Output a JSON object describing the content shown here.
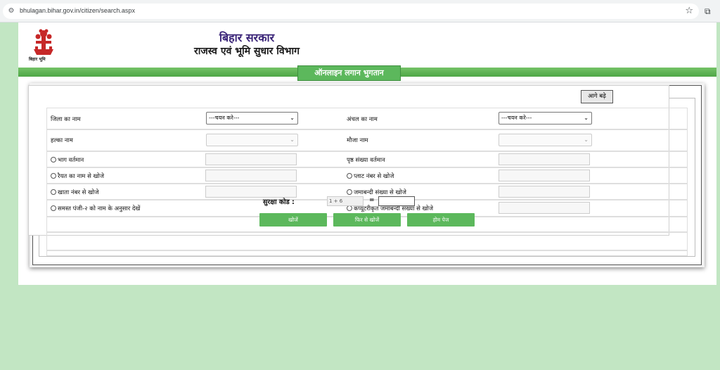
{
  "browser": {
    "url": "bhulagan.bihar.gov.in/citizen/search.aspx"
  },
  "header": {
    "emblem_caption": "बिहार भूमि",
    "title_line1": "बिहार सरकार",
    "title_line2": "राजस्व एवं भूमि सुधार विभाग"
  },
  "panel": {
    "legend": "ऑनलाइन लगान भुगतान"
  },
  "form": {
    "district_label": "जिला का नाम",
    "district_value": "---चयन करे---",
    "circle_label": "अंचल का नाम",
    "circle_value": "---चयन करे---",
    "next_button": "आगे बढ़े",
    "halka_label": "हल्का नाम",
    "mauja_label": "मौजा नाम",
    "bhag_label": "भाग वर्तमान",
    "page_label": "पृष्ठ संख्या वर्तमान",
    "raiyat_label": "रैयत का नाम से खोजे",
    "plot_label": "प्लाट नंबर से खोजे",
    "khata_label": "खाता नंबर से खोजे",
    "jamabandi_label": "जमाबन्दी संख्या से खोजे",
    "register_label": "समस्त पंजी-२ को नाम के अनुसार देखें",
    "computer_label": "कंप्यूटरीकृत जमाबन्दी संख्या से खोजे",
    "captcha_label": "सुरक्षा कोड :",
    "captcha_value": "1 + 6",
    "captcha_equals": "=",
    "search_button": "खोजें",
    "research_button": "फिर से खोजें",
    "home_button": "होम पेज"
  },
  "colors": {
    "page_bg": "#c2e6c3",
    "green": "#5cb85c",
    "title_purple": "#3a2478"
  }
}
